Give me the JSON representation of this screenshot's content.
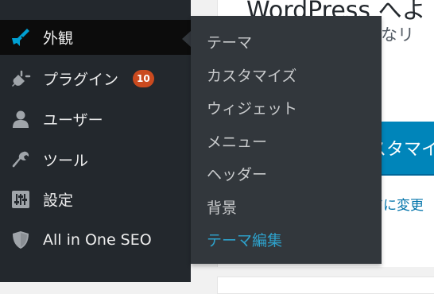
{
  "sidebar": {
    "items": [
      {
        "label": "外観",
        "icon": "paintbrush-icon",
        "active": true
      },
      {
        "label": "プラグイン",
        "icon": "plugin-icon",
        "badge": "10"
      },
      {
        "label": "ユーザー",
        "icon": "user-icon"
      },
      {
        "label": "ツール",
        "icon": "wrench-icon"
      },
      {
        "label": "設定",
        "icon": "settings-sliders-icon"
      },
      {
        "label": "All in One SEO",
        "icon": "shield-icon"
      }
    ]
  },
  "submenu": {
    "items": [
      {
        "label": "テーマ"
      },
      {
        "label": "カスタマイズ"
      },
      {
        "label": "ウィジェット"
      },
      {
        "label": "メニュー"
      },
      {
        "label": "ヘッダー"
      },
      {
        "label": "背景"
      },
      {
        "label": "テーマ編集",
        "current": true
      }
    ]
  },
  "main": {
    "welcome_title": "WordPress へよ",
    "welcome_subtitle": "利なリ",
    "customize_button": "スタマイ",
    "change_link": "アに変更"
  },
  "colors": {
    "sidebar_bg": "#23282d",
    "active_bg": "#0c0c0c",
    "submenu_bg": "#32373c",
    "badge": "#ca4a1f",
    "current_link": "#2ea2cc",
    "button_bg": "#0085ba"
  }
}
